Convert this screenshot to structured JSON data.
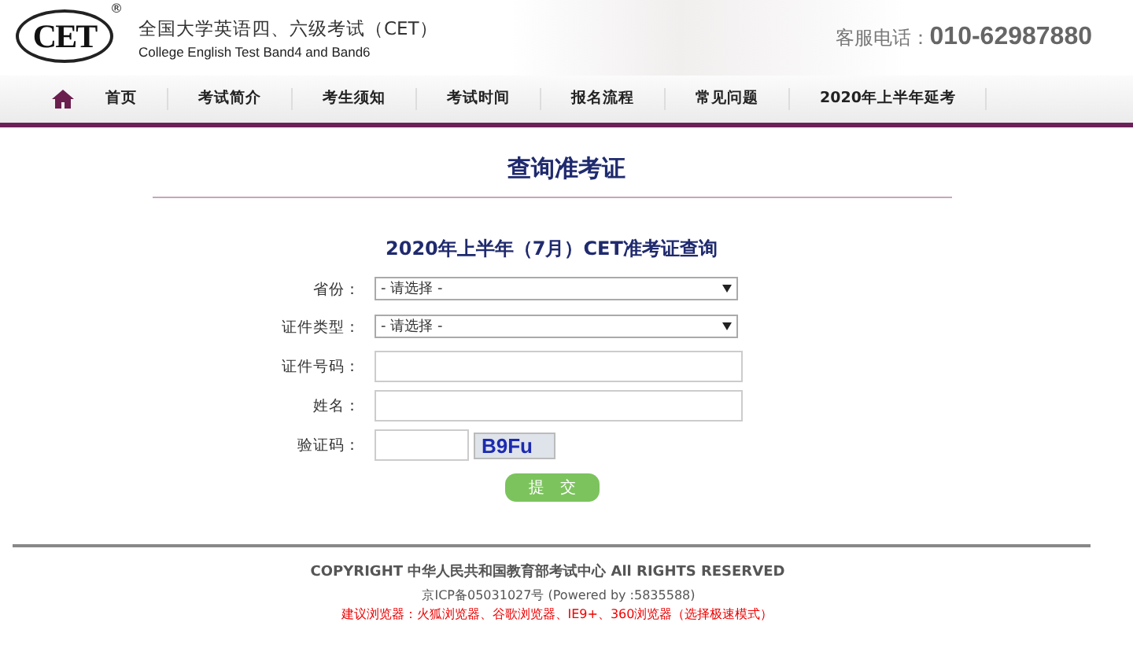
{
  "header": {
    "logo": "CET",
    "logo_mark": "®",
    "title": "全国大学英语四、六级考试（CET）",
    "subtitle": "College English Test Band4 and Band6",
    "phone_label": "客服电话：",
    "phone": "010-62987880"
  },
  "nav": [
    "首页",
    "考试简介",
    "考生须知",
    "考试时间",
    "报名流程",
    "常见问题",
    "2020年上半年延考"
  ],
  "page_title": "查询准考证",
  "form": {
    "title": "2020年上半年（7月）CET准考证查询",
    "fields": [
      {
        "kind": "select",
        "label": "省份：",
        "value": "- 请选择 -"
      },
      {
        "kind": "select",
        "label": "证件类型：",
        "value": "- 请选择 -"
      },
      {
        "kind": "text",
        "label": "证件号码："
      },
      {
        "kind": "text",
        "label": "姓名："
      },
      {
        "kind": "captcha",
        "label": "验证码：",
        "captcha": "B9Fu"
      }
    ],
    "submit": "提　交"
  },
  "footer": {
    "copyright": "COPYRIGHT 中华人民共和国教育部考试中心 All RIGHTS RESERVED",
    "icp": "京ICP备05031027号 (Powered by :5835588)",
    "browsers": "建议浏览器：火狐浏览器、谷歌浏览器、IE9+、360浏览器（选择极速模式）"
  }
}
